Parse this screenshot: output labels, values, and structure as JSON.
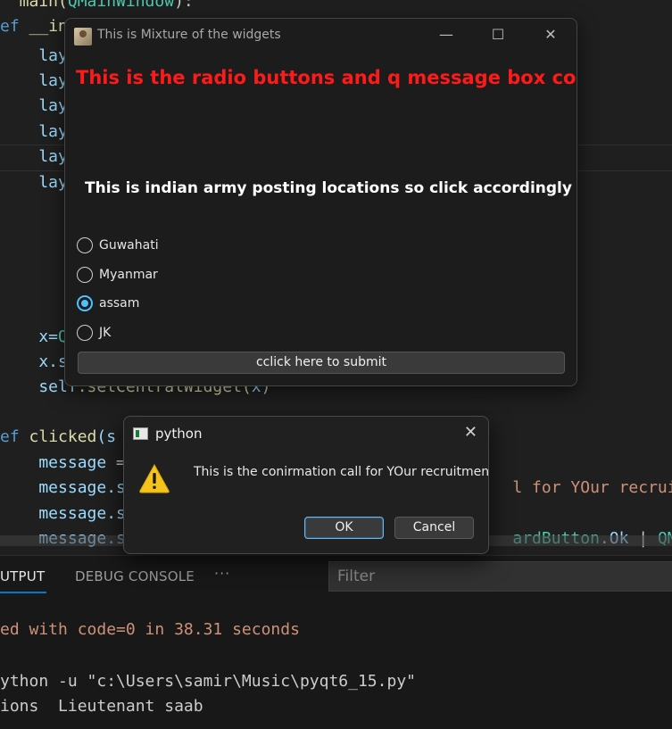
{
  "editor": {
    "lines": [
      [
        {
          "t": "  main(",
          "c": "fn"
        },
        {
          "t": "QMainWindow",
          "c": "cls"
        },
        {
          "t": "):",
          "c": ""
        }
      ],
      [
        {
          "t": "ef ",
          "c": "kw"
        },
        {
          "t": "__in",
          "c": "fn"
        }
      ],
      [
        {
          "t": "    lay",
          "c": "var"
        }
      ],
      [
        {
          "t": "    lay",
          "c": "var"
        }
      ],
      [
        {
          "t": "    lay",
          "c": "var"
        }
      ],
      [
        {
          "t": "    lay",
          "c": "var"
        }
      ],
      [
        {
          "t": "    lay",
          "c": "var"
        }
      ],
      [
        {
          "t": "    lay",
          "c": "var"
        }
      ],
      [
        {
          "t": "    x=",
          "c": "var"
        },
        {
          "t": "QW",
          "c": "cls"
        }
      ],
      [
        {
          "t": "    x.se",
          "c": "var"
        }
      ],
      [
        {
          "t": "    self",
          "c": "var"
        },
        {
          "t": ".setCentralWidget(",
          "c": "fn"
        },
        {
          "t": "x",
          "c": "var"
        },
        {
          "t": ")",
          "c": ""
        }
      ],
      [
        {
          "t": "ef ",
          "c": "kw"
        },
        {
          "t": "clicked",
          "c": "fn"
        },
        {
          "t": "(s",
          "c": "var"
        }
      ],
      [
        {
          "t": "    message ",
          "c": "var"
        },
        {
          "t": "=",
          "c": ""
        }
      ],
      [
        {
          "t": "    message.s",
          "c": "var"
        },
        {
          "t": "                                        l for YOur recruitm",
          "c": "str"
        }
      ],
      [
        {
          "t": "    message.s",
          "c": "var"
        }
      ],
      [
        {
          "t": "    message.s",
          "c": "var"
        },
        {
          "t": "                                        ardButton",
          "c": "cls"
        },
        {
          "t": ".",
          "c": ""
        },
        {
          "t": "Ok",
          "c": "var"
        },
        {
          "t": " | ",
          "c": ""
        },
        {
          "t": "QMes",
          "c": "cls"
        }
      ]
    ]
  },
  "panel": {
    "tabs": [
      "UTPUT",
      "DEBUG CONSOLE"
    ],
    "more": "···",
    "filter_placeholder": "Filter",
    "output": [
      "ed with code=0 in 38.31 seconds",
      "ython -u \"c:\\Users\\samir\\Music\\pyqt6_15.py\"",
      "ions  Lieutenant saab"
    ]
  },
  "main_window": {
    "title": "This is Mixture of the widgets",
    "heading": "This is the radio buttons and q message box code",
    "subheading": "This is indian army posting locations so click accordingly",
    "options": [
      {
        "label": "Guwahati",
        "checked": false
      },
      {
        "label": "Myanmar",
        "checked": false
      },
      {
        "label": "assam",
        "checked": true
      },
      {
        "label": "JK",
        "checked": false
      }
    ],
    "submit_label": "cclick here to submit",
    "heading_color": "#ff1a1a",
    "accent": "#4cc2ff",
    "controls": {
      "minimize": "—",
      "maximize": "☐",
      "close": "✕"
    }
  },
  "message_box": {
    "title": "python",
    "text": "This is the conirmation call for YOur recruitment",
    "icon": "warning-icon",
    "ok_label": "OK",
    "cancel_label": "Cancel",
    "close": "✕"
  }
}
